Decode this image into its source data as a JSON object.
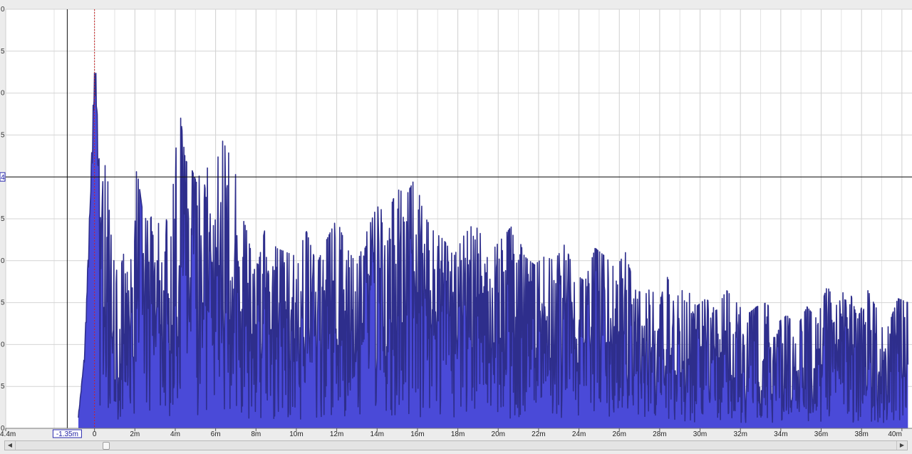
{
  "chart_data": {
    "type": "line",
    "title": "",
    "xlabel": "",
    "ylabel": "",
    "x_unit": "m",
    "xlim": [
      -4.4,
      40.5
    ],
    "ylim": [
      0,
      1
    ],
    "grid": true,
    "x_ticks": [
      "4.4m",
      "0",
      "2m",
      "4m",
      "6m",
      "8m",
      "10m",
      "12m",
      "14m",
      "16m",
      "18m",
      "20m",
      "22m",
      "24m",
      "26m",
      "28m",
      "30m",
      "32m",
      "34m",
      "36m",
      "38m",
      "40m"
    ],
    "x_tick_values": [
      -4.4,
      0,
      2,
      4,
      6,
      8,
      10,
      12,
      14,
      16,
      18,
      20,
      22,
      24,
      26,
      28,
      30,
      32,
      34,
      36,
      38,
      40
    ],
    "y_tick_fragments": [
      "0",
      "5",
      "0",
      "5",
      "4",
      "5",
      "0",
      "5",
      "0",
      "5",
      "0"
    ],
    "cursor": {
      "x_label": "-1.35m",
      "x_value": -1.35,
      "y_label": "4",
      "y_value": 0.6,
      "peak_marker_x": 0
    },
    "series": [
      {
        "color": "#2e2e8c",
        "fill": "#4a4ad8",
        "x": [
          -0.8,
          -0.5,
          -0.3,
          -0.1,
          0.0,
          0.1,
          0.2,
          0.35,
          0.5,
          0.7,
          0.9,
          1.2,
          1.5,
          1.8,
          2.1,
          2.4,
          2.7,
          3.0,
          3.3,
          3.6,
          3.9,
          4.2,
          4.5,
          4.8,
          5.1,
          5.4,
          5.7,
          6.0,
          6.3,
          6.6,
          6.9,
          7.2,
          7.5,
          7.8,
          8.1,
          8.5,
          9.0,
          9.5,
          10.0,
          10.5,
          11.0,
          11.5,
          12.0,
          12.5,
          13.0,
          13.5,
          14.0,
          14.5,
          15.0,
          15.5,
          15.9,
          16.3,
          16.8,
          17.3,
          17.8,
          18.3,
          18.8,
          19.3,
          19.8,
          20.3,
          20.8,
          21.3,
          21.8,
          22.3,
          22.8,
          23.3,
          23.8,
          24.3,
          24.8,
          25.3,
          25.8,
          26.3,
          26.8,
          27.3,
          27.8,
          28.3,
          28.8,
          29.3,
          29.8,
          30.3,
          30.8,
          31.3,
          31.8,
          32.3,
          32.8,
          33.3,
          33.8,
          34.3,
          34.8,
          35.3,
          35.8,
          36.3,
          36.8,
          37.3,
          37.8,
          38.3,
          38.8,
          39.3,
          39.8,
          40.3
        ],
        "values": [
          0.03,
          0.18,
          0.44,
          0.72,
          0.95,
          0.81,
          0.68,
          0.76,
          0.79,
          0.54,
          0.41,
          0.36,
          0.43,
          0.52,
          0.62,
          0.51,
          0.49,
          0.53,
          0.55,
          0.49,
          0.58,
          0.77,
          0.64,
          0.62,
          0.58,
          0.66,
          0.6,
          0.62,
          0.69,
          0.66,
          0.64,
          0.52,
          0.48,
          0.41,
          0.39,
          0.49,
          0.43,
          0.42,
          0.41,
          0.47,
          0.39,
          0.45,
          0.5,
          0.43,
          0.39,
          0.47,
          0.53,
          0.51,
          0.57,
          0.56,
          0.6,
          0.51,
          0.47,
          0.45,
          0.41,
          0.46,
          0.49,
          0.45,
          0.43,
          0.46,
          0.49,
          0.41,
          0.39,
          0.41,
          0.4,
          0.44,
          0.37,
          0.35,
          0.43,
          0.41,
          0.38,
          0.42,
          0.33,
          0.32,
          0.35,
          0.37,
          0.31,
          0.34,
          0.29,
          0.31,
          0.28,
          0.33,
          0.3,
          0.27,
          0.29,
          0.3,
          0.25,
          0.27,
          0.24,
          0.29,
          0.26,
          0.34,
          0.29,
          0.35,
          0.26,
          0.33,
          0.28,
          0.24,
          0.31,
          0.3
        ]
      }
    ]
  },
  "scrollbar": {
    "left_arrow_icon": "chevron-left-icon",
    "right_arrow_icon": "chevron-right-icon",
    "position": 0.1
  }
}
